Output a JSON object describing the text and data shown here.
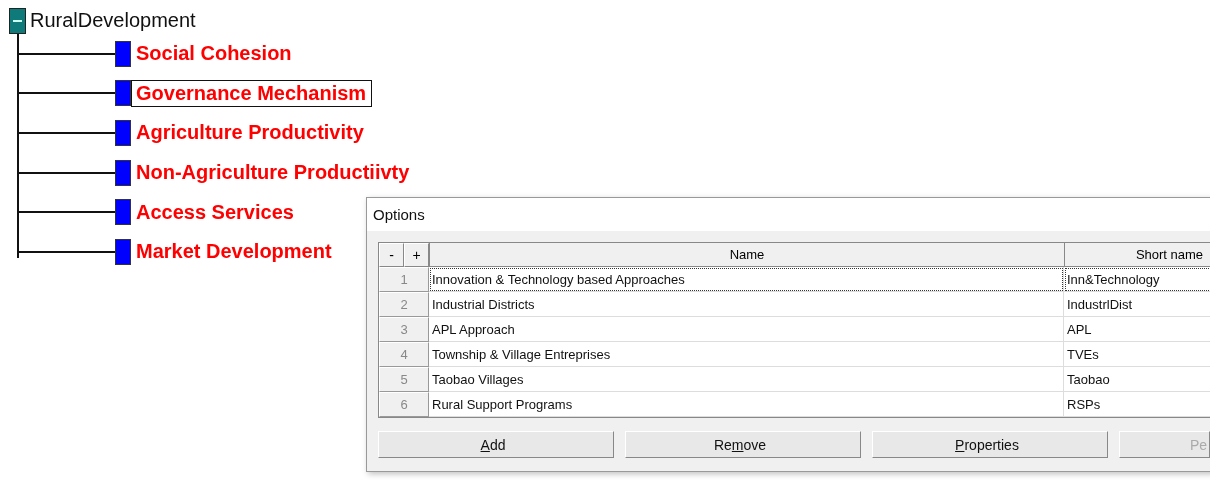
{
  "tree": {
    "root": {
      "label": "RuralDevelopment",
      "expanded": true,
      "children": [
        {
          "label": "Social Cohesion",
          "selected": false
        },
        {
          "label": "Governance Mechanism",
          "selected": true
        },
        {
          "label": "Agriculture Productivity",
          "selected": false
        },
        {
          "label": "Non-Agriculture Productiivty",
          "selected": false
        },
        {
          "label": "Access Services",
          "selected": false
        },
        {
          "label": "Market Development",
          "selected": false
        }
      ]
    }
  },
  "dialog": {
    "title": "Options",
    "table": {
      "collapse_button": "-",
      "expand_button": "+",
      "columns": [
        "Name",
        "Short name"
      ],
      "rows": [
        {
          "number": "1",
          "name": "Innovation & Technology based Approaches",
          "short_name": "Inn&Technology",
          "focused": true
        },
        {
          "number": "2",
          "name": "Industrial Districts",
          "short_name": "IndustrlDist",
          "focused": false
        },
        {
          "number": "3",
          "name": "APL Approach",
          "short_name": "APL",
          "focused": false
        },
        {
          "number": "4",
          "name": "Township & Village Entreprises",
          "short_name": "TVEs",
          "focused": false
        },
        {
          "number": "5",
          "name": "Taobao Villages",
          "short_name": "Taobao",
          "focused": false
        },
        {
          "number": "6",
          "name": "Rural Support Programs",
          "short_name": "RSPs",
          "focused": false
        }
      ]
    },
    "buttons": [
      {
        "key": "A",
        "after": "dd",
        "disabled": false
      },
      {
        "before": "Re",
        "key": "m",
        "after": "ove",
        "disabled": false
      },
      {
        "key": "P",
        "after": "roperties",
        "disabled": false
      },
      {
        "before": "Pe",
        "disabled": true
      }
    ]
  }
}
